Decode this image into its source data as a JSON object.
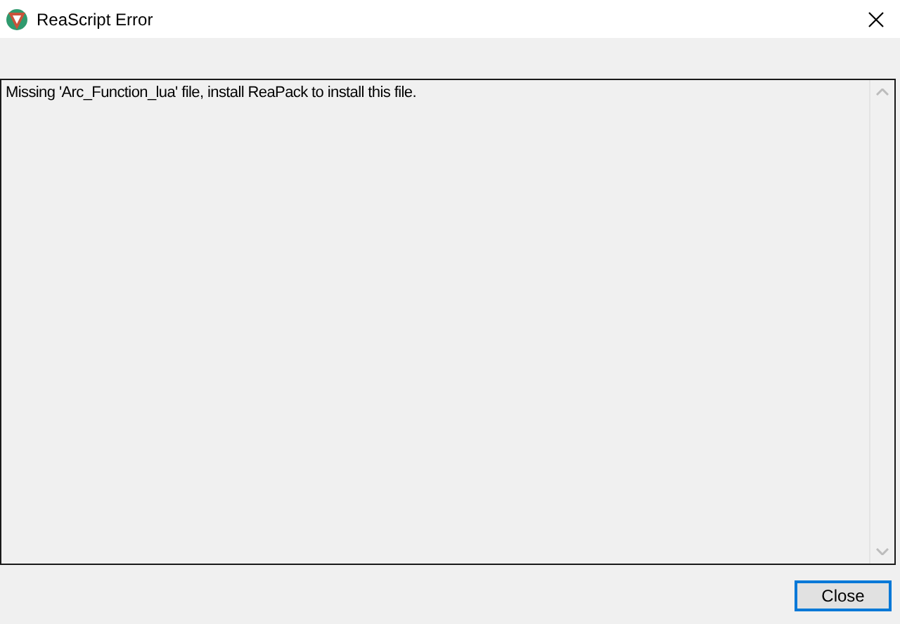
{
  "window": {
    "title": "ReaScript Error"
  },
  "message": "Missing 'Arc_Function_lua' file, install ReaPack to install this file.",
  "buttons": [
    {
      "label": "Close",
      "selected": true
    }
  ]
}
